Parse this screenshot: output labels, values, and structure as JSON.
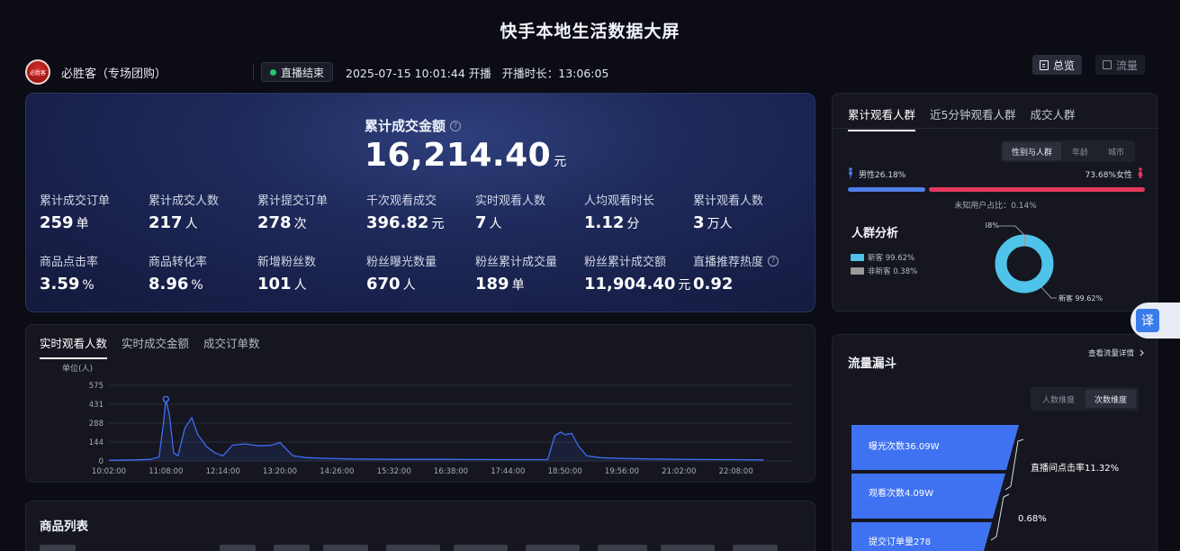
{
  "page": {
    "title": "快手本地生活数据大屏"
  },
  "header": {
    "logo_text": "必胜客",
    "store_name": "必胜客（专场团购）",
    "live_status": "直播结束",
    "live_start": "2025-07-15 10:01:44 开播",
    "live_duration": "开播时长：13:06:05",
    "tabs": [
      {
        "label": "总览",
        "active": true
      },
      {
        "label": "流量",
        "active": false
      }
    ]
  },
  "kpi": {
    "main": {
      "label": "累计成交金额",
      "value": "16,214.40",
      "unit": "元"
    },
    "items": [
      {
        "label": "累计成交订单",
        "value": "259",
        "unit": "单"
      },
      {
        "label": "累计成交人数",
        "value": "217",
        "unit": "人"
      },
      {
        "label": "累计提交订单",
        "value": "278",
        "unit": "次"
      },
      {
        "label": "千次观看成交",
        "value": "396.82",
        "unit": "元"
      },
      {
        "label": "实时观看人数",
        "value": "7",
        "unit": "人"
      },
      {
        "label": "人均观看时长",
        "value": "1.12",
        "unit": "分"
      },
      {
        "label": "累计观看人数",
        "value": "3",
        "unit": "万人"
      },
      {
        "label": "商品点击率",
        "value": "3.59",
        "unit": "%"
      },
      {
        "label": "商品转化率",
        "value": "8.96",
        "unit": "%"
      },
      {
        "label": "新增粉丝数",
        "value": "101",
        "unit": "人"
      },
      {
        "label": "粉丝曝光数量",
        "value": "670",
        "unit": "人"
      },
      {
        "label": "粉丝累计成交量",
        "value": "189",
        "unit": "单"
      },
      {
        "label": "粉丝累计成交额",
        "value": "11,904.40",
        "unit": "元"
      },
      {
        "label": "直播推荐热度",
        "value": "0.92",
        "unit": "",
        "help": true
      }
    ]
  },
  "realtime": {
    "tabs": [
      {
        "label": "实时观看人数",
        "active": true
      },
      {
        "label": "实时成交金额",
        "active": false
      },
      {
        "label": "成交订单数",
        "active": false
      }
    ],
    "line_color": "#3d6df2"
  },
  "chart_data": {
    "type": "line",
    "ylabel": "单位(人)",
    "ylim": [
      0,
      575
    ],
    "yticks": [
      "575",
      "431",
      "288",
      "144",
      "0"
    ],
    "xticks": [
      "10:02:00",
      "11:08:00",
      "12:14:00",
      "13:20:00",
      "14:26:00",
      "15:32:00",
      "16:38:00",
      "17:44:00",
      "18:50:00",
      "19:56:00",
      "21:02:00",
      "22:08:00"
    ],
    "series": [
      {
        "x": [
          "10:02",
          "10:30",
          "10:50",
          "11:00",
          "11:05",
          "11:08",
          "11:12",
          "11:17",
          "11:22",
          "11:30",
          "11:38",
          "11:45",
          "11:55",
          "12:05",
          "12:14",
          "12:25",
          "12:40",
          "12:55",
          "13:10",
          "13:20",
          "13:35",
          "13:50",
          "14:05",
          "14:15",
          "14:26",
          "14:45",
          "15:32",
          "16:38",
          "17:44",
          "18:30",
          "18:38",
          "18:45",
          "18:50",
          "18:58",
          "19:05",
          "19:15",
          "19:30",
          "19:56",
          "20:30",
          "21:02",
          "22:08",
          "22:40"
        ],
        "values": [
          5,
          8,
          12,
          30,
          280,
          470,
          350,
          60,
          40,
          250,
          330,
          200,
          110,
          60,
          40,
          120,
          130,
          115,
          120,
          140,
          40,
          25,
          22,
          20,
          18,
          15,
          12,
          12,
          10,
          10,
          190,
          220,
          200,
          210,
          120,
          40,
          25,
          20,
          15,
          12,
          10,
          8
        ]
      }
    ]
  },
  "products": {
    "title": "商品列表"
  },
  "audience": {
    "tabs": [
      {
        "label": "累计观看人群",
        "active": true
      },
      {
        "label": "近5分钟观看人群",
        "active": false
      },
      {
        "label": "成交人群",
        "active": false
      }
    ],
    "seg": [
      {
        "label": "性别与人群",
        "active": true
      },
      {
        "label": "年龄",
        "active": false
      },
      {
        "label": "城市",
        "active": false
      }
    ],
    "male_label": "男性26.18%",
    "female_label": "73.68%女性",
    "male_pct": 26.18,
    "female_pct": 73.68,
    "male_color": "#4f7fe8",
    "female_color": "#e5395d",
    "unknown_note": "未知用户占比：0.14%",
    "crowd_title": "人群分析",
    "legend": [
      {
        "label": "新客 99.62%",
        "color": "#4fc3e9"
      },
      {
        "label": "非新客 0.38%",
        "color": "#9a9a9a"
      }
    ],
    "donut_labels": {
      "old": "非新客 0.38%",
      "new": "新客 99.62%"
    },
    "donut_pcts": {
      "new": 99.62,
      "old": 0.38
    }
  },
  "flow": {
    "title": "流量漏斗",
    "detail_link": "查看流量详情",
    "seg": [
      {
        "label": "人数维度",
        "active": false
      },
      {
        "label": "次数维度",
        "active": true
      }
    ],
    "stages": [
      {
        "label": "曝光次数36.09W"
      },
      {
        "label": "观看次数4.09W"
      },
      {
        "label": "提交订单量278"
      }
    ],
    "rates": [
      "直播间点击率11.32%",
      "0.68%"
    ],
    "funnel_color": "#3f72f0"
  },
  "translate": {
    "label": "译"
  }
}
